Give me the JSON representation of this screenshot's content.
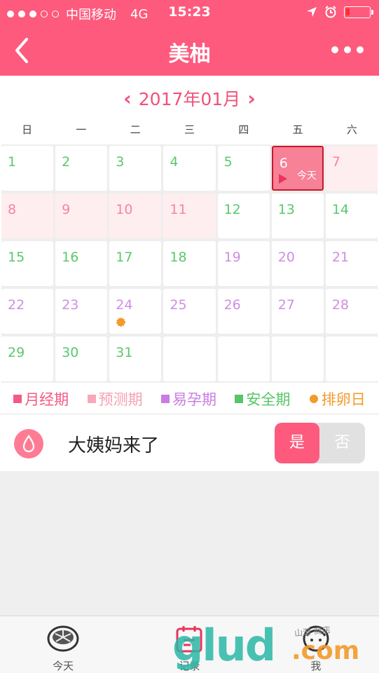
{
  "status_bar": {
    "carrier": "中国移动",
    "network": "4G",
    "time": "15:23"
  },
  "navbar": {
    "title": "美柚"
  },
  "calendar": {
    "month_title": "2017年01月",
    "prev_arrow": "‹",
    "next_arrow": "›",
    "weekdays": [
      "日",
      "一",
      "二",
      "三",
      "四",
      "五",
      "六"
    ],
    "days": {
      "d1": "1",
      "d2": "2",
      "d3": "3",
      "d4": "4",
      "d5": "5",
      "d6": "6",
      "d7": "7",
      "d8": "8",
      "d9": "9",
      "d10": "10",
      "d11": "11",
      "d12": "12",
      "d13": "13",
      "d14": "14",
      "d15": "15",
      "d16": "16",
      "d17": "17",
      "d18": "18",
      "d19": "19",
      "d20": "20",
      "d21": "21",
      "d22": "22",
      "d23": "23",
      "d24": "24",
      "d25": "25",
      "d26": "26",
      "d27": "27",
      "d28": "28",
      "d29": "29",
      "d30": "30",
      "d31": "31"
    },
    "today_label": "今天"
  },
  "legend": {
    "period": "月经期",
    "predicted": "预测期",
    "fertile": "易孕期",
    "safe": "安全期",
    "ovulation": "排卵日"
  },
  "period_toggle": {
    "label": "大姨妈来了",
    "yes": "是",
    "no": "否"
  },
  "tabbar": {
    "today": "今天",
    "record": "记录",
    "me": "我"
  },
  "watermark": {
    "brand": "glud",
    "domain": ".com",
    "cn": "山渐 商店"
  },
  "colors": {
    "accent": "#fd5a7d",
    "safe": "#5ac86b",
    "fertile": "#cf8ee3",
    "predicted": "#f5859f",
    "ovulation": "#f39a2a"
  }
}
